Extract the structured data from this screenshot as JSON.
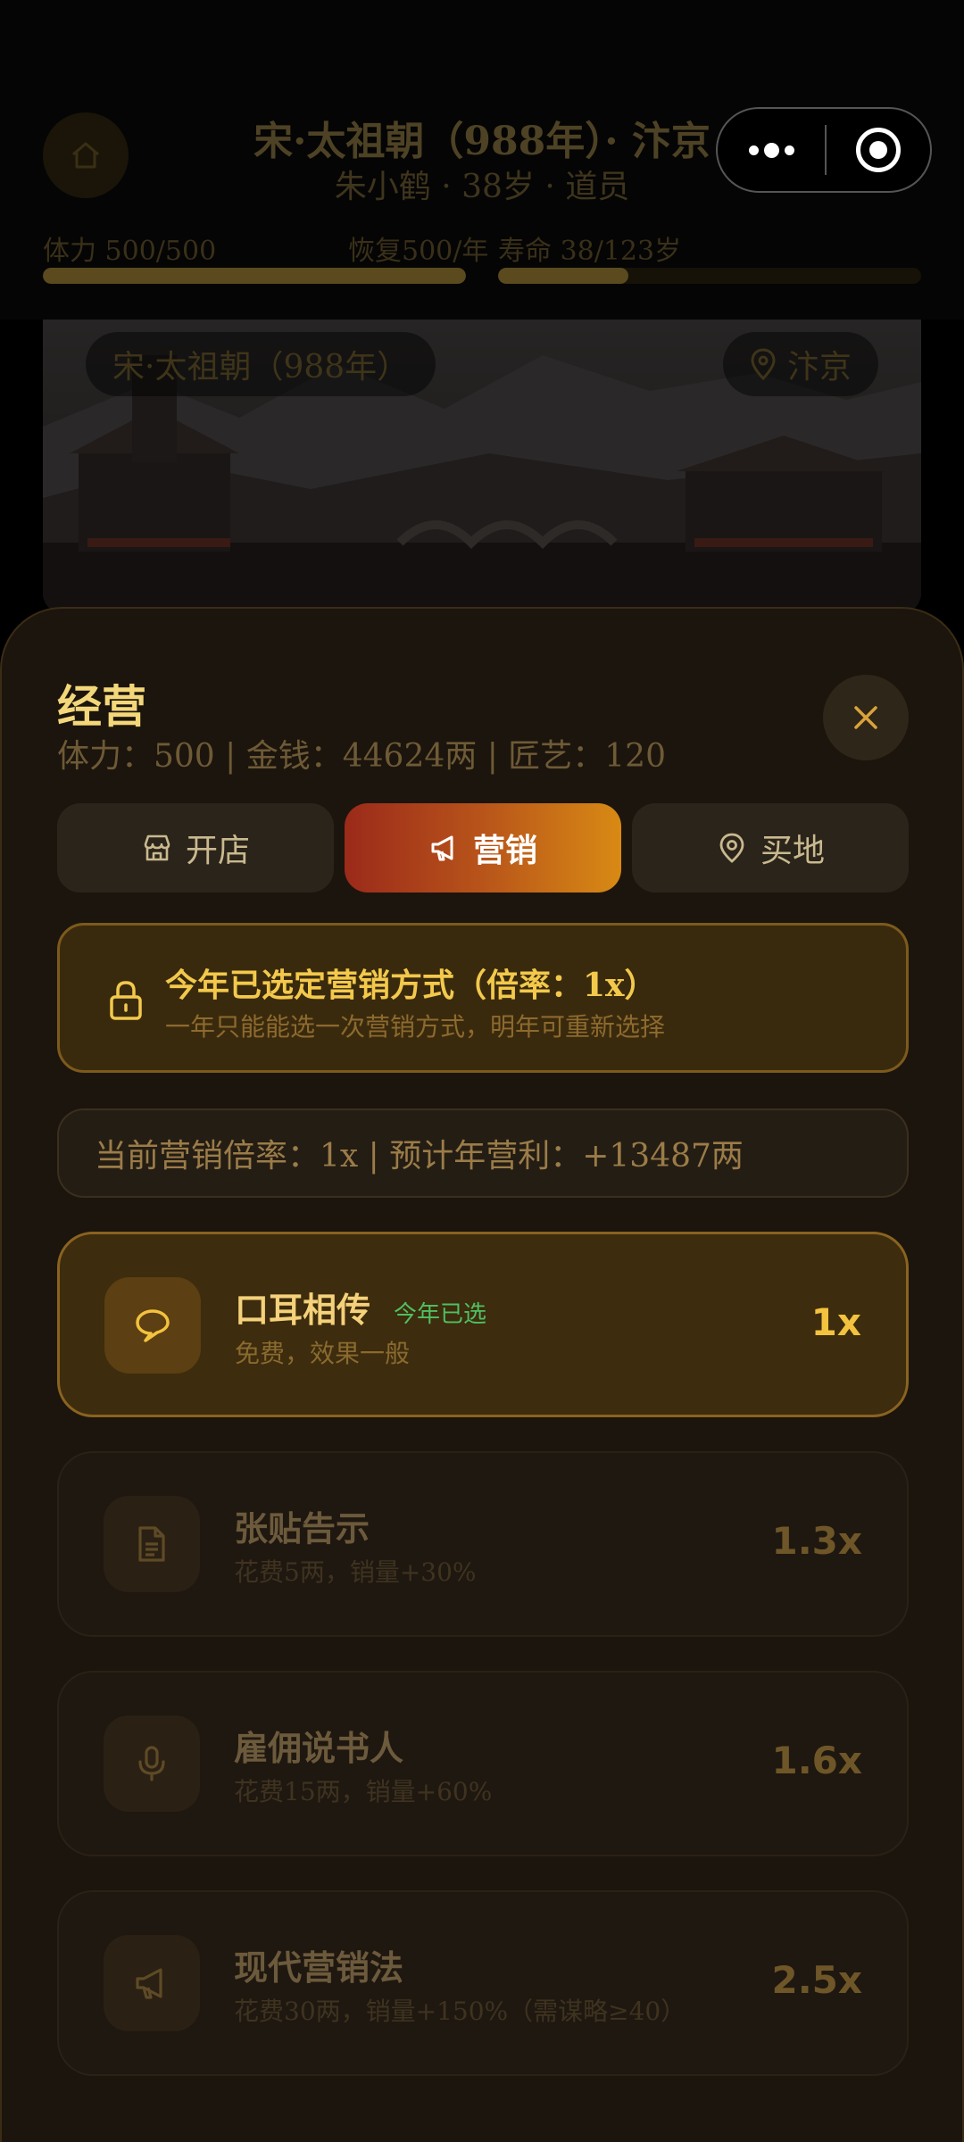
{
  "header": {
    "era_title": "宋·太祖朝（988年）· 汴京",
    "character_subtitle": "朱小鹤 · 38岁 · 道员",
    "stamina_label": "体力 500/500",
    "stamina_recover": "恢复500/年",
    "stamina_fraction": 1.0,
    "lifespan_label": "寿命 38/123岁",
    "lifespan_fraction": 0.309
  },
  "scene": {
    "era_chip": "宋·太祖朝（988年）",
    "location_chip": "汴京"
  },
  "sheet": {
    "title": "经营",
    "stats": "体力：500 | 金钱：44624两 | 匠艺：120",
    "close_icon": "close-icon",
    "tabs": [
      {
        "label": "开店",
        "icon": "shop-icon",
        "active": false
      },
      {
        "label": "营销",
        "icon": "megaphone-icon",
        "active": true
      },
      {
        "label": "买地",
        "icon": "map-pin-icon",
        "active": false
      }
    ],
    "notice": {
      "title": "今年已选定营销方式（倍率：1x）",
      "subtitle": "一年只能能选一次营销方式，明年可重新选择"
    },
    "current_rate": "当前营销倍率：1x | 预计年营利：+13487两",
    "options": [
      {
        "name": "口耳相传",
        "badge": "今年已选",
        "desc": "免费，效果一般",
        "rate": "1x",
        "icon": "chat-bubble-icon",
        "selected": true
      },
      {
        "name": "张贴告示",
        "badge": "",
        "desc": "花费5两，销量+30%",
        "rate": "1.3x",
        "icon": "document-icon",
        "selected": false
      },
      {
        "name": "雇佣说书人",
        "badge": "",
        "desc": "花费15两，销量+60%",
        "rate": "1.6x",
        "icon": "microphone-icon",
        "selected": false
      },
      {
        "name": "现代营销法",
        "badge": "",
        "desc": "花费30两，销量+150%（需谋略≥40）",
        "rate": "2.5x",
        "icon": "megaphone-icon",
        "selected": false
      }
    ]
  },
  "colors": {
    "accent_gold": "#f3c23e",
    "sheet_bg": "#1c150d",
    "active_tab_start": "#9b2a1a",
    "active_tab_end": "#d88a14",
    "selected_badge": "#4fc061"
  }
}
